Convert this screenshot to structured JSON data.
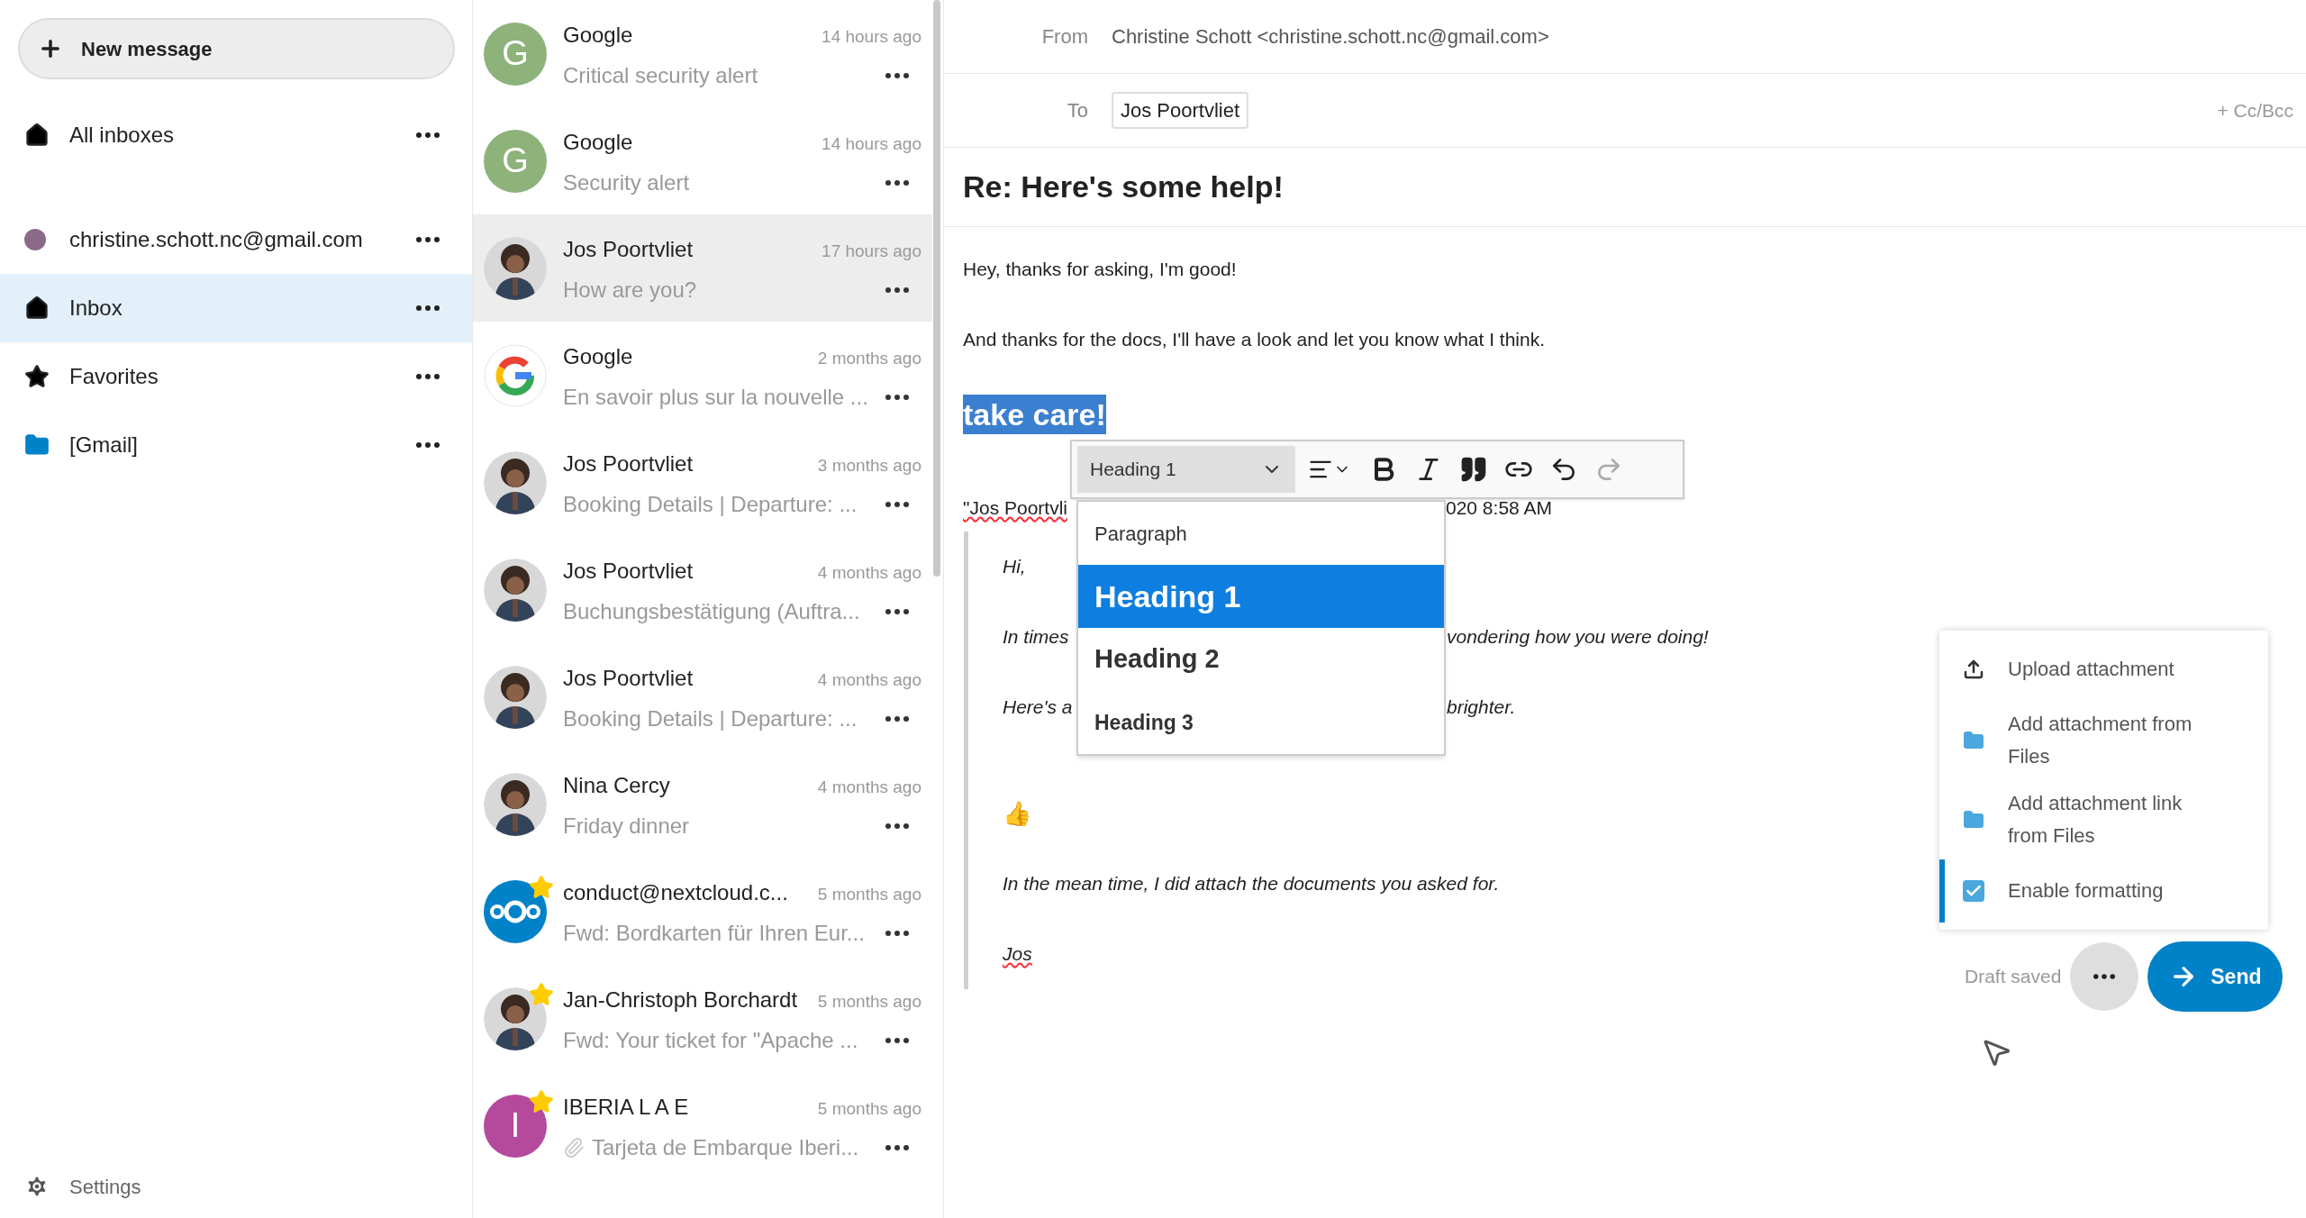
{
  "new_message_button": {
    "label": "New message"
  },
  "sidebar": {
    "items": [
      {
        "kind": "all",
        "label": "All inboxes",
        "selected": false
      },
      {
        "kind": "account",
        "label": "christine.schott.nc@gmail.com",
        "selected": false,
        "color": "#8b6a85"
      },
      {
        "kind": "inbox",
        "label": "Inbox",
        "selected": true
      },
      {
        "kind": "favorites",
        "label": "Favorites",
        "selected": false
      },
      {
        "kind": "folder",
        "label": "[Gmail]",
        "selected": false
      }
    ],
    "settings": "Settings"
  },
  "messages": [
    {
      "sender": "Google",
      "time": "14 hours ago",
      "subject": "Critical security alert",
      "selected": false,
      "starred": false,
      "avatar": {
        "kind": "letter",
        "letter": "G",
        "color": "#8db27a"
      }
    },
    {
      "sender": "Google",
      "time": "14 hours ago",
      "subject": "Security alert",
      "selected": false,
      "starred": false,
      "avatar": {
        "kind": "letter",
        "letter": "G",
        "color": "#8db27a"
      }
    },
    {
      "sender": "Jos Poortvliet",
      "time": "17 hours ago",
      "subject": "How are you?",
      "selected": true,
      "starred": false
    },
    {
      "sender": "Google",
      "time": "2 months ago",
      "subject": "En savoir plus sur la nouvelle ...",
      "selected": false,
      "starred": false,
      "avatar": {
        "kind": "google"
      }
    },
    {
      "sender": "Jos Poortvliet",
      "time": "3 months ago",
      "subject": "Booking Details | Departure: ...",
      "selected": false,
      "starred": false
    },
    {
      "sender": "Jos Poortvliet",
      "time": "4 months ago",
      "subject": "Buchungsbestätigung (Auftra...",
      "selected": false,
      "starred": false
    },
    {
      "sender": "Jos Poortvliet",
      "time": "4 months ago",
      "subject": "Booking Details | Departure: ...",
      "selected": false,
      "starred": false
    },
    {
      "sender": "Nina Cercy",
      "time": "4 months ago",
      "subject": "Friday dinner",
      "selected": false,
      "starred": false
    },
    {
      "sender": "conduct@nextcloud.c...",
      "time": "5 months ago",
      "subject": "Fwd: Bordkarten für Ihren Eur...",
      "selected": false,
      "starred": true,
      "avatar": {
        "kind": "nextcloud"
      }
    },
    {
      "sender": "Jan-Christoph Borchardt",
      "time": "5 months ago",
      "subject": "Fwd: Your ticket for \"Apache ...",
      "selected": false,
      "starred": true
    },
    {
      "sender": "IBERIA L A E",
      "time": "5 months ago",
      "subject": "Tarjeta de Embarque Iberi...",
      "selected": false,
      "starred": true,
      "attachment": true,
      "avatar": {
        "kind": "letter",
        "letter": "I",
        "color": "#b5499c"
      }
    }
  ],
  "composer": {
    "from_label": "From",
    "from": "Christine Schott <christine.schott.nc@gmail.com>",
    "to_label": "To",
    "to": [
      "Jos Poortvliet"
    ],
    "cc_bcc": "+ Cc/Bcc",
    "subject": "Re: Here's some help!",
    "body": [
      "Hey, thanks for asking, I'm good!",
      "And thanks for the docs, I'll have a look and let you know what I think."
    ],
    "heading": {
      "text": "take care!",
      "selected": true
    },
    "quote_header": {
      "left": "\"Jos Poortvli",
      "right": "020 8:58 AM",
      "misspelled": true
    },
    "quote": [
      {
        "kind": "text",
        "left": "Hi,"
      },
      {
        "kind": "text",
        "left": "In times",
        "right": "vondering how you were doing!"
      },
      {
        "kind": "text",
        "left": "Here's a",
        "right": "brighter."
      },
      {
        "kind": "emoji",
        "left": "👍"
      },
      {
        "kind": "text",
        "left": "In the mean time, I did attach the documents you asked for."
      },
      {
        "kind": "signature",
        "left": "Jos",
        "misspelled": true
      }
    ],
    "toolbar": {
      "block_select": "Heading 1",
      "redo_disabled": true
    },
    "block_menu": [
      {
        "kind": "paragraph",
        "label": "Paragraph",
        "selected": false
      },
      {
        "kind": "h1",
        "label": "Heading 1",
        "selected": true
      },
      {
        "kind": "h2",
        "label": "Heading 2",
        "selected": false
      },
      {
        "kind": "h3",
        "label": "Heading 3",
        "selected": false
      }
    ],
    "actions_menu": [
      {
        "kind": "upload",
        "label": "Upload attachment",
        "selected": false
      },
      {
        "kind": "files",
        "label": "Add attachment from Files",
        "selected": false
      },
      {
        "kind": "files",
        "label": "Add attachment link from Files",
        "selected": false
      },
      {
        "kind": "checkbox",
        "label": "Enable formatting",
        "checked": true,
        "selected": true
      }
    ],
    "draft_status": "Draft saved",
    "send_button": "Send"
  }
}
